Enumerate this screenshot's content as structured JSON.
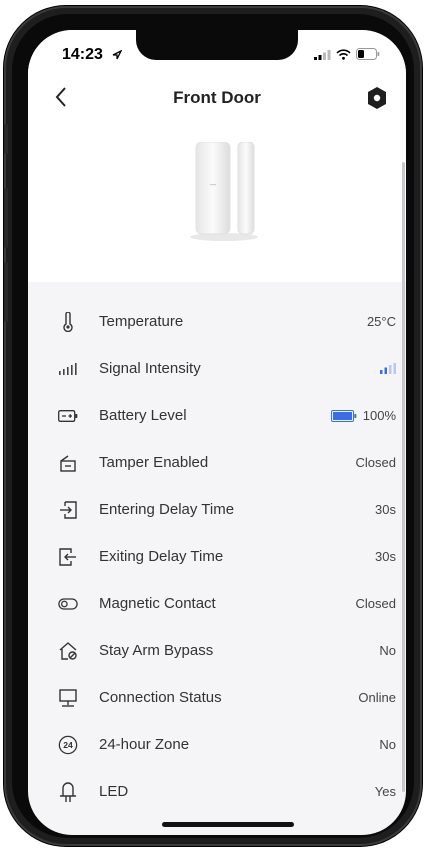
{
  "status_bar": {
    "time": "14:23"
  },
  "header": {
    "title": "Front Door"
  },
  "rows": [
    {
      "label": "Temperature",
      "value": "25°C",
      "icon": "thermometer-icon"
    },
    {
      "label": "Signal Intensity",
      "value": "",
      "icon": "signal-icon"
    },
    {
      "label": "Battery Level",
      "value": "100%",
      "icon": "battery-icon"
    },
    {
      "label": "Tamper Enabled",
      "value": "Closed",
      "icon": "tamper-icon"
    },
    {
      "label": "Entering Delay Time",
      "value": "30s",
      "icon": "enter-icon"
    },
    {
      "label": "Exiting Delay Time",
      "value": "30s",
      "icon": "exit-icon"
    },
    {
      "label": "Magnetic Contact",
      "value": "Closed",
      "icon": "magnet-toggle-icon"
    },
    {
      "label": "Stay Arm Bypass",
      "value": "No",
      "icon": "home-bypass-icon"
    },
    {
      "label": "Connection Status",
      "value": "Online",
      "icon": "monitor-icon"
    },
    {
      "label": "24-hour Zone",
      "value": "No",
      "icon": "24h-icon",
      "icon_text": "24"
    },
    {
      "label": "LED",
      "value": "Yes",
      "icon": "led-icon"
    }
  ],
  "colors": {
    "accent_blue": "#3a6ee8",
    "signal_weak": "#b8c8f0",
    "text": "#333333"
  }
}
